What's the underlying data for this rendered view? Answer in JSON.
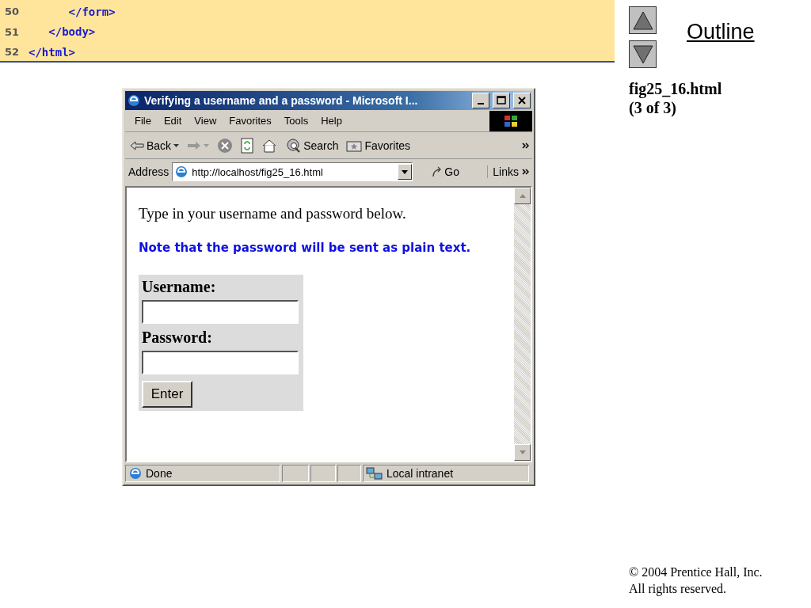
{
  "code_lines": [
    {
      "number": "50",
      "code": "      </form>"
    },
    {
      "number": "51",
      "code": "   </body>"
    },
    {
      "number": "52",
      "code": "</html>"
    }
  ],
  "outline": {
    "label": "Outline",
    "caption": [
      "fig25_16.html",
      "(3 of 3)"
    ]
  },
  "browser": {
    "title": "Verifying a username and a password - Microsoft I...",
    "menu": [
      "File",
      "Edit",
      "View",
      "Favorites",
      "Tools",
      "Help"
    ],
    "toolbar": [
      {
        "kind": "back",
        "label": "Back",
        "disabled": false
      },
      {
        "kind": "forward",
        "disabled": true
      },
      {
        "kind": "stop",
        "disabled": false
      },
      {
        "kind": "refresh",
        "disabled": false
      },
      {
        "kind": "home",
        "disabled": false
      },
      {
        "kind": "search",
        "label": "Search",
        "disabled": false
      },
      {
        "kind": "favorites",
        "label": "Favorites",
        "disabled": false
      }
    ],
    "address": {
      "label": "Address",
      "url": "http://localhost/fig25_16.html",
      "go": "Go",
      "links": "Links"
    },
    "page": {
      "intro": "Type in your username and password below.",
      "note": "Note that the password will be sent as plain text.",
      "fields": [
        {
          "label": "Username:"
        },
        {
          "label": "Password:"
        }
      ],
      "submit": "Enter"
    },
    "status": {
      "text": "Done",
      "zone": "Local intranet"
    }
  },
  "copyright": [
    "© 2004 Prentice Hall, Inc.",
    "All rights reserved."
  ]
}
